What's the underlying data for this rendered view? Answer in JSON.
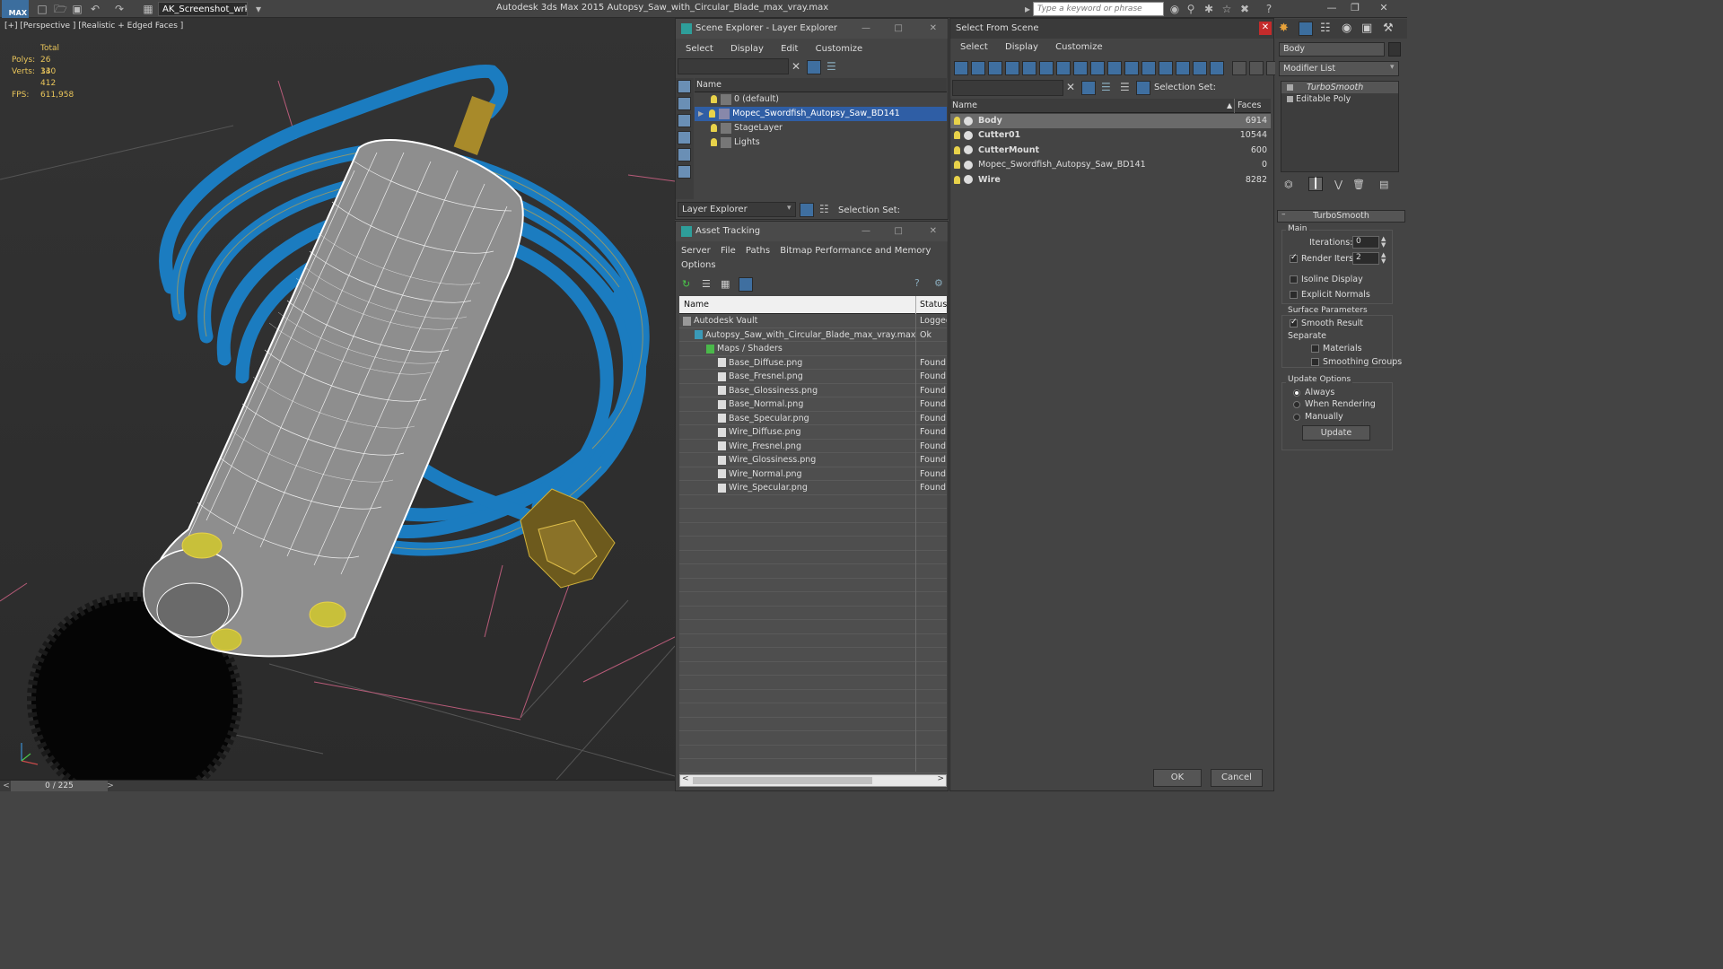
{
  "app": {
    "workspace": "AK_Screenshot_wrksp",
    "title": "Autodesk 3ds Max  2015      Autopsy_Saw_with_Circular_Blade_max_vray.max",
    "search_placeholder": "Type a keyword or phrase",
    "logo": "MAX"
  },
  "viewport": {
    "label": "[+] [Perspective ] [Realistic + Edged Faces ]",
    "stats_header": "Total",
    "polys_label": "Polys:",
    "polys": "26 340",
    "verts_label": "Verts:",
    "verts": "13 412",
    "fps_label": "FPS:",
    "fps": "611,958"
  },
  "timeline": {
    "frame": "0 / 225"
  },
  "scene_explorer": {
    "title": "Scene Explorer - Layer Explorer",
    "menu": [
      "Select",
      "Display",
      "Edit",
      "Customize"
    ],
    "column": "Name",
    "layers": [
      {
        "name": "0 (default)",
        "selected": false
      },
      {
        "name": "Mopec_Swordfish_Autopsy_Saw_BD141",
        "selected": true
      },
      {
        "name": "StageLayer",
        "selected": false
      },
      {
        "name": "Lights",
        "selected": false
      }
    ],
    "footer_dropdown": "Layer Explorer",
    "selection_set_label": "Selection Set:"
  },
  "asset_tracking": {
    "title": "Asset Tracking",
    "menu": [
      "Server",
      "File",
      "Paths",
      "Bitmap Performance and Memory"
    ],
    "menu2": "Options",
    "columns": [
      "Name",
      "Status"
    ],
    "rows": [
      {
        "name": "Autodesk Vault",
        "status": "Logged",
        "indent": 0,
        "icon": "vault-icon"
      },
      {
        "name": "Autopsy_Saw_with_Circular_Blade_max_vray.max",
        "status": "Ok",
        "indent": 1,
        "icon": "max-file-icon"
      },
      {
        "name": "Maps / Shaders",
        "status": "",
        "indent": 2,
        "icon": "maps-icon"
      },
      {
        "name": "Base_Diffuse.png",
        "status": "Found",
        "indent": 3,
        "icon": "bitmap-icon"
      },
      {
        "name": "Base_Fresnel.png",
        "status": "Found",
        "indent": 3,
        "icon": "bitmap-icon"
      },
      {
        "name": "Base_Glossiness.png",
        "status": "Found",
        "indent": 3,
        "icon": "bitmap-icon"
      },
      {
        "name": "Base_Normal.png",
        "status": "Found",
        "indent": 3,
        "icon": "bitmap-icon"
      },
      {
        "name": "Base_Specular.png",
        "status": "Found",
        "indent": 3,
        "icon": "bitmap-icon"
      },
      {
        "name": "Wire_Diffuse.png",
        "status": "Found",
        "indent": 3,
        "icon": "bitmap-icon"
      },
      {
        "name": "Wire_Fresnel.png",
        "status": "Found",
        "indent": 3,
        "icon": "bitmap-icon"
      },
      {
        "name": "Wire_Glossiness.png",
        "status": "Found",
        "indent": 3,
        "icon": "bitmap-icon"
      },
      {
        "name": "Wire_Normal.png",
        "status": "Found",
        "indent": 3,
        "icon": "bitmap-icon"
      },
      {
        "name": "Wire_Specular.png",
        "status": "Found",
        "indent": 3,
        "icon": "bitmap-icon"
      }
    ]
  },
  "select_from_scene": {
    "title": "Select From Scene",
    "menu": [
      "Select",
      "Display",
      "Customize"
    ],
    "selection_set_label": "Selection Set:",
    "columns": [
      "Name",
      "Faces"
    ],
    "rows": [
      {
        "name": "Body",
        "faces": "6914",
        "bold": true,
        "highlight": true
      },
      {
        "name": "Cutter01",
        "faces": "10544",
        "bold": true,
        "highlight": false
      },
      {
        "name": "CutterMount",
        "faces": "600",
        "bold": true,
        "highlight": false
      },
      {
        "name": "Mopec_Swordfish_Autopsy_Saw_BD141",
        "faces": "0",
        "bold": false,
        "highlight": false
      },
      {
        "name": "Wire",
        "faces": "8282",
        "bold": true,
        "highlight": false
      }
    ],
    "ok": "OK",
    "cancel": "Cancel"
  },
  "modify_panel": {
    "object_name": "Body",
    "modifier_list": "Modifier List",
    "stack": [
      "TurboSmooth",
      "Editable Poly"
    ],
    "rollout_title": "TurboSmooth",
    "main_label": "Main",
    "iterations_label": "Iterations:",
    "iterations": "0",
    "render_iters_label": "Render Iters:",
    "render_iters": "2",
    "isoline_label": "Isoline Display",
    "explicit_normals_label": "Explicit Normals",
    "surface_params_label": "Surface Parameters",
    "smooth_result_label": "Smooth Result",
    "separate_label": "Separate",
    "materials_label": "Materials",
    "smoothing_groups_label": "Smoothing Groups",
    "update_options_label": "Update Options",
    "always_label": "Always",
    "when_rendering_label": "When Rendering",
    "manually_label": "Manually",
    "update_button": "Update"
  },
  "colors": {
    "selection": "#2f5ea5",
    "wire": "#1f7fc4",
    "yellow": "#e8c45a"
  }
}
